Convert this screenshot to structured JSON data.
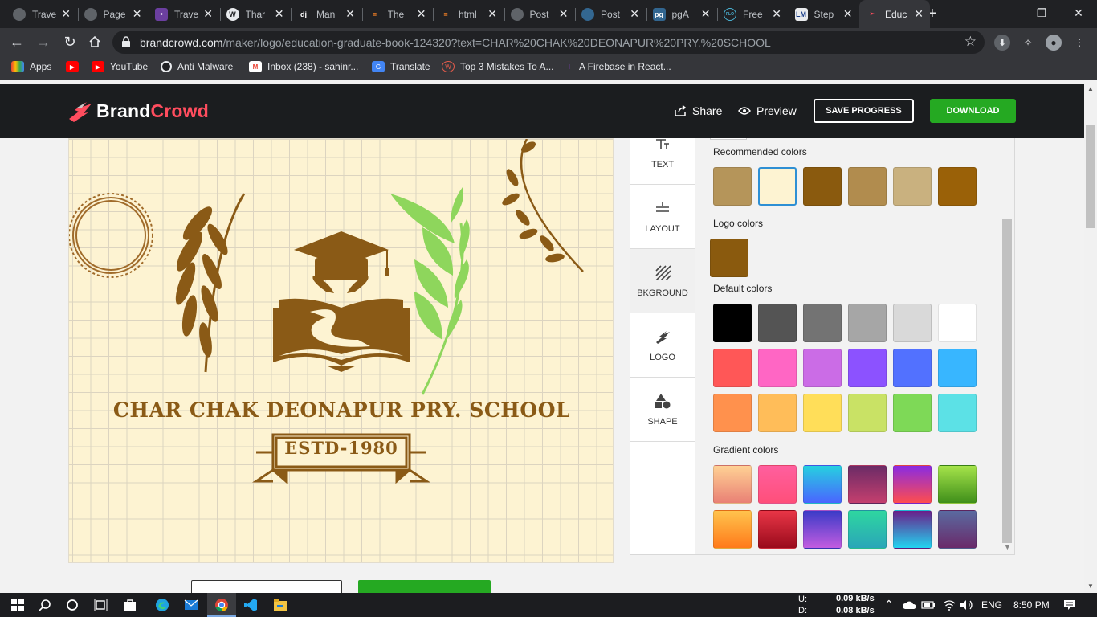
{
  "browser": {
    "tabs": [
      {
        "label": "Trave",
        "icon": "globe-icon",
        "active": false
      },
      {
        "label": "Page",
        "icon": "globe-icon",
        "active": false
      },
      {
        "label": "Trave",
        "icon": "colorlib-icon",
        "active": false
      },
      {
        "label": "Thar",
        "icon": "wordpress-icon",
        "active": false
      },
      {
        "label": "Man",
        "icon": "django-icon",
        "active": false
      },
      {
        "label": "The",
        "icon": "stackoverflow-icon",
        "active": false
      },
      {
        "label": "html",
        "icon": "stackoverflow-icon",
        "active": false
      },
      {
        "label": "Post",
        "icon": "globe-icon",
        "active": false
      },
      {
        "label": "Post",
        "icon": "postgres-icon",
        "active": false
      },
      {
        "label": "pgA",
        "icon": "pgadmin-icon",
        "active": false
      },
      {
        "label": "Free",
        "icon": "flo-icon",
        "active": false
      },
      {
        "label": "Step",
        "icon": "lm-icon",
        "active": false
      },
      {
        "label": "Educ",
        "icon": "brandcrowd-icon",
        "active": true
      }
    ],
    "url_domain": "brandcrowd.com",
    "url_path": "/maker/logo/education-graduate-book-124320?text=CHAR%20CHAK%20DEONAPUR%20PRY.%20SCHOOL",
    "bookmarks": [
      {
        "label": "Apps",
        "icon": "apps-grid-icon"
      },
      {
        "label": "",
        "icon": "youtube-icon"
      },
      {
        "label": "YouTube",
        "icon": "youtube-icon"
      },
      {
        "label": "Anti Malware",
        "icon": "anti-malware-icon"
      },
      {
        "label": "Inbox (238) - sahinr...",
        "icon": "gmail-icon"
      },
      {
        "label": "Translate",
        "icon": "translate-icon"
      },
      {
        "label": "Top 3 Mistakes To A...",
        "icon": "wp-icon"
      },
      {
        "label": "A Firebase in React...",
        "icon": "firebase-icon"
      }
    ]
  },
  "header": {
    "brand_part1": "Brand",
    "brand_part2": "Crowd",
    "share_label": "Share",
    "preview_label": "Preview",
    "save_label": "SAVE PROGRESS",
    "download_label": "DOWNLOAD"
  },
  "logo": {
    "school_name": "CHAR CHAK DEONAPUR PRY. SCHOOL",
    "estd": "ESTD-1980",
    "primary_color": "#8a5a16",
    "leaf_color": "#8ed65c",
    "background_color": "#fdf3d2"
  },
  "tools": [
    {
      "label": "TEXT",
      "icon": "text-icon"
    },
    {
      "label": "LAYOUT",
      "icon": "layout-icon"
    },
    {
      "label": "BKGROUND",
      "icon": "background-icon",
      "active": true
    },
    {
      "label": "LOGO",
      "icon": "logo-icon"
    },
    {
      "label": "SHAPE",
      "icon": "shape-icon"
    }
  ],
  "colors_panel": {
    "recommended_title": "Recommended colors",
    "recommended": [
      "#b5955a",
      "#fdf3d2",
      "#8a5a0e",
      "#b18c4e",
      "#c9b17f",
      "#9a6108"
    ],
    "recommended_selected_index": 1,
    "logo_title": "Logo colors",
    "logo": [
      "#8a5a0e"
    ],
    "default_title": "Default colors",
    "default": [
      "#000000",
      "#545454",
      "#737373",
      "#a6a6a6",
      "#d9d9d9",
      "#ffffff",
      "#ff5757",
      "#ff66c4",
      "#cb6ce6",
      "#8c52ff",
      "#5271ff",
      "#38b6ff",
      "#ff914d",
      "#ffbd59",
      "#ffde59",
      "#c9e265",
      "#7ed957",
      "#5ce1e6"
    ],
    "gradient_title": "Gradient colors",
    "gradients": [
      [
        "#ffd194",
        "#e98075"
      ],
      [
        "#ff5f9e",
        "#ff4f7a"
      ],
      [
        "#26d0e0",
        "#4a64ff"
      ],
      [
        "#6b2b66",
        "#c53f6e"
      ],
      [
        "#8a2be2",
        "#ff4d4d"
      ],
      [
        "#a5e34a",
        "#3f8f1a"
      ],
      [
        "#ffc34d",
        "#ff7a1a"
      ],
      [
        "#e83546",
        "#9a0b1c"
      ],
      [
        "#3b3bc7",
        "#c25ce0"
      ],
      [
        "#2ed6a0",
        "#2aa6b8"
      ],
      [
        "#6a1f8a",
        "#22d3f0"
      ],
      [
        "#5a6aa0",
        "#6a2a6a"
      ]
    ]
  },
  "taskbar": {
    "net_up_label": "U:",
    "net_up_value": "0.09 kB/s",
    "net_down_label": "D:",
    "net_down_value": "0.08 kB/s",
    "language": "ENG",
    "time": "8:50 PM"
  }
}
